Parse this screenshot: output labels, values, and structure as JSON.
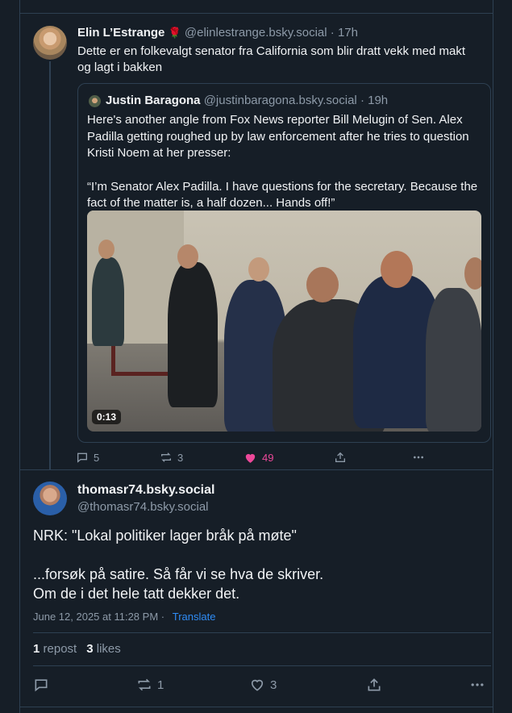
{
  "post1": {
    "author_name": "Elin L’Estrange",
    "author_emoji": "🌹",
    "handle": "@elinlestrange.bsky.social",
    "separator": "·",
    "time": "17h",
    "text": "Dette er en folkevalgt senator fra California som blir dratt vekk med makt og lagt i bakken",
    "actions": {
      "replies": "5",
      "reposts": "3",
      "likes": "49"
    },
    "colors": {
      "like_active": "#ec4899"
    }
  },
  "quote": {
    "author_name": "Justin Baragona",
    "handle": "@justinbaragona.bsky.social",
    "separator": "·",
    "time": "19h",
    "paragraph1": "Here's another angle from Fox News reporter Bill Melugin of Sen. Alex Padilla getting roughed up by law enforcement after he tries to question Kristi Noem at her presser:",
    "paragraph2": "“I’m Senator Alex Padilla. I have questions for the secretary. Because the fact of the matter is, a half dozen... Hands off!”",
    "video_duration": "0:13"
  },
  "post2": {
    "display_name": "thomasr74.bsky.social",
    "handle": "@thomasr74.bsky.social",
    "line1": "NRK: \"Lokal politiker lager bråk på møte\"",
    "line2": "...forsøk på satire. Så får vi se hva de skriver.",
    "line3": "Om de i det hele tatt dekker det.",
    "timestamp": "June 12, 2025 at 11:28 PM",
    "dot": "·",
    "translate_label": "Translate",
    "repost_count": "1",
    "repost_label": "repost",
    "like_count": "3",
    "like_label": "likes",
    "actions": {
      "reposts": "1",
      "likes": "3"
    }
  },
  "colors": {
    "background": "#161e27",
    "border": "#2e4052",
    "muted": "#8d9aa8",
    "link": "#2f8cf5"
  }
}
